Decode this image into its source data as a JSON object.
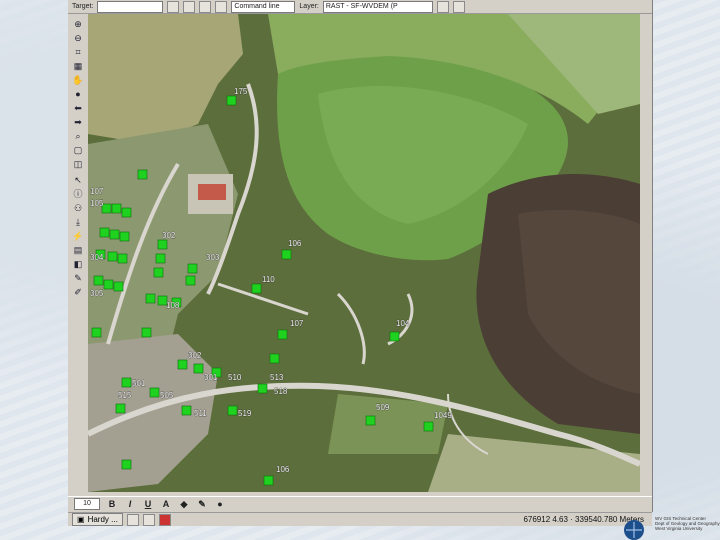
{
  "toolbar": {
    "target_label": "Target:",
    "command_line_label": "Command line",
    "layer_label": "Layer:",
    "layer_value": "RAST - SF-WVDEM (P"
  },
  "map": {
    "parcel_labels": [
      "175",
      "107",
      "105",
      "302",
      "304",
      "303",
      "305",
      "106",
      "110",
      "107",
      "302",
      "301",
      "505",
      "519",
      "501",
      "108",
      "513",
      "510",
      "518",
      "104",
      "106",
      "509",
      "1049",
      "511",
      "515"
    ],
    "marker_color": "#1fd21f",
    "road_color": "#d9d6cf"
  },
  "format_bar": {
    "font_size": "10",
    "bold": "B",
    "italic": "I",
    "underline": "U"
  },
  "taskbar": {
    "task_label": "Hardy ...",
    "status": "676912 4.63 · 339540.780 Meters"
  },
  "branding": {
    "line1": "WV GIS Technical Center",
    "line2": "Dept of Geology and Geography",
    "line3": "West Virginia University"
  }
}
